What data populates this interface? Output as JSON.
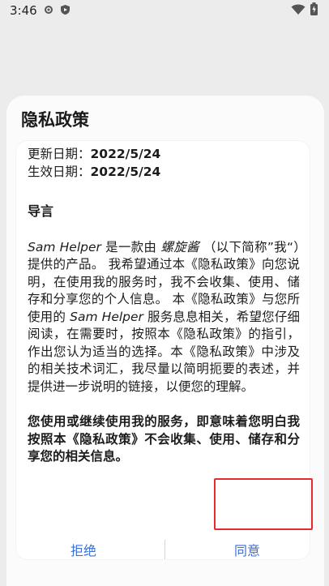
{
  "status_bar": {
    "time": "3:46",
    "icons": [
      "gear-icon",
      "play-protect-icon",
      "wifi-icon",
      "battery-icon"
    ]
  },
  "dialog": {
    "title": "隐私政策",
    "updated_label": "更新日期：",
    "updated_value": "2022/5/24",
    "effective_label": "生效日期：",
    "effective_value": "2022/5/24",
    "section_title": "导言",
    "intro": {
      "app_name": "Sam Helper",
      "text1": " 是一款由 ",
      "author": "螺旋酱",
      "text2": " （以下简称”我“）提供的产品。 我希望通过本《隐私政策》向您说明，在使用我的服务时，我不会收集、使用、储存和分享您的个人信息。 本《隐私政策》与您所使用的 ",
      "app_name2": "Sam Helper",
      "text3": " 服务息息相关，希望您仔细阅读，在需要时，按照本《隐私政策》的指引，作出您认为适当的选择。本《隐私政策》中涉及的相关技术词汇，我尽量以简明扼要的表述，并提供进一步说明的链接，以便您的理解。"
    },
    "bold_para": "您使用或继续使用我的服务，即意味着您明白我按照本《隐私政策》不会收集、使用、储存和分享您的相关信息。",
    "reject_label": "拒绝",
    "accept_label": "同意"
  },
  "colors": {
    "accent": "#3d6fd8",
    "highlight": "#e52b2b",
    "background": "#ececec",
    "dialog": "#fbfbfb"
  }
}
